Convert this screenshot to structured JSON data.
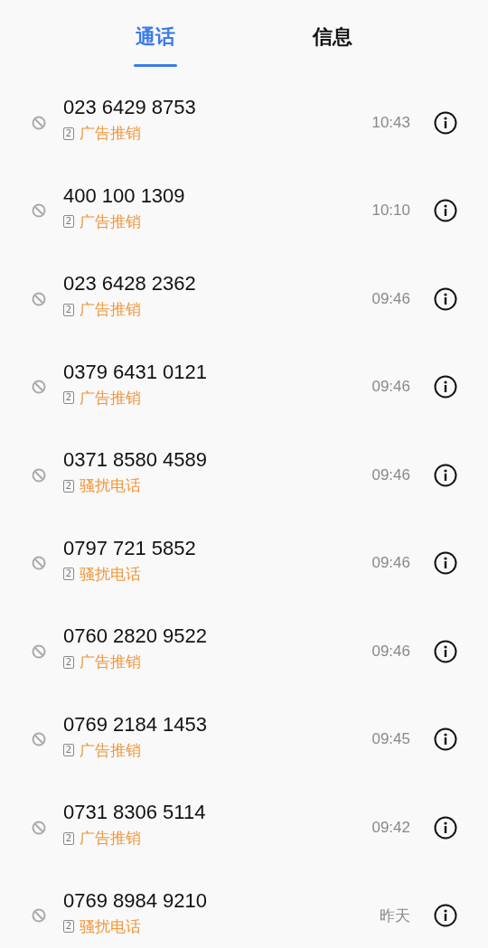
{
  "tabs": [
    {
      "label": "通话",
      "selected": true
    },
    {
      "label": "信息",
      "selected": false
    }
  ],
  "calls": [
    {
      "number": "023 6429 8753",
      "sim": "2",
      "tag": "广告推销",
      "time": "10:43"
    },
    {
      "number": "400 100 1309",
      "sim": "2",
      "tag": "广告推销",
      "time": "10:10"
    },
    {
      "number": "023 6428 2362",
      "sim": "2",
      "tag": "广告推销",
      "time": "09:46"
    },
    {
      "number": "0379 6431 0121",
      "sim": "2",
      "tag": "广告推销",
      "time": "09:46"
    },
    {
      "number": "0371 8580 4589",
      "sim": "2",
      "tag": "骚扰电话",
      "time": "09:46"
    },
    {
      "number": "0797 721 5852",
      "sim": "2",
      "tag": "骚扰电话",
      "time": "09:46"
    },
    {
      "number": "0760 2820 9522",
      "sim": "2",
      "tag": "广告推销",
      "time": "09:46"
    },
    {
      "number": "0769 2184 1453",
      "sim": "2",
      "tag": "广告推销",
      "time": "09:45"
    },
    {
      "number": "0731 8306 5114",
      "sim": "2",
      "tag": "广告推销",
      "time": "09:42"
    },
    {
      "number": "0769 8984 9210",
      "sim": "2",
      "tag": "骚扰电话",
      "time": "昨天"
    }
  ]
}
